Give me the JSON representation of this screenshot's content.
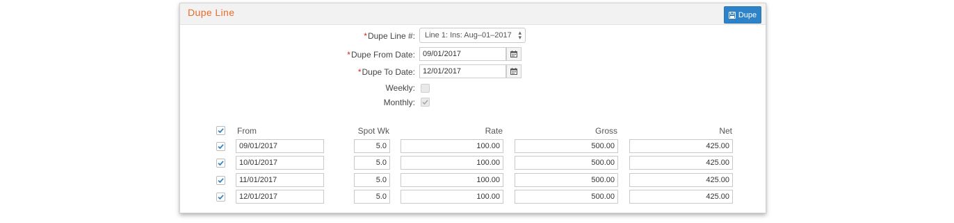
{
  "panel": {
    "title": "Dupe Line",
    "dupe_button_label": "Dupe"
  },
  "form": {
    "required_marker": "*",
    "dupe_line_label": "Dupe Line #:",
    "dupe_line_value": "Line 1: Ins: Aug–01–2017",
    "dupe_from_label": "Dupe From Date:",
    "dupe_from_value": "09/01/2017",
    "dupe_to_label": "Dupe To Date:",
    "dupe_to_value": "12/01/2017",
    "weekly_label": "Weekly:",
    "weekly_checked": false,
    "monthly_label": "Monthly:",
    "monthly_checked": true
  },
  "table": {
    "headers": {
      "from": "From",
      "spot_wk": "Spot Wk",
      "rate": "Rate",
      "gross": "Gross",
      "net": "Net"
    },
    "select_all_checked": true,
    "rows": [
      {
        "checked": true,
        "from": "09/01/2017",
        "spot_wk": "5.0",
        "rate": "100.00",
        "gross": "500.00",
        "net": "425.00"
      },
      {
        "checked": true,
        "from": "10/01/2017",
        "spot_wk": "5.0",
        "rate": "100.00",
        "gross": "500.00",
        "net": "425.00"
      },
      {
        "checked": true,
        "from": "11/01/2017",
        "spot_wk": "5.0",
        "rate": "100.00",
        "gross": "500.00",
        "net": "425.00"
      },
      {
        "checked": true,
        "from": "12/01/2017",
        "spot_wk": "5.0",
        "rate": "100.00",
        "gross": "500.00",
        "net": "425.00"
      }
    ]
  },
  "icons": {
    "save": "floppy-disk-icon",
    "calendar": "calendar-icon",
    "check": "checkmark-icon",
    "select_arrows": "up-down-arrows-icon"
  },
  "colors": {
    "title": "#ea6a2a",
    "button": "#2e83c8",
    "required": "#d9231b",
    "check_blue": "#2e83c8",
    "check_gray": "#a8a8a8"
  }
}
